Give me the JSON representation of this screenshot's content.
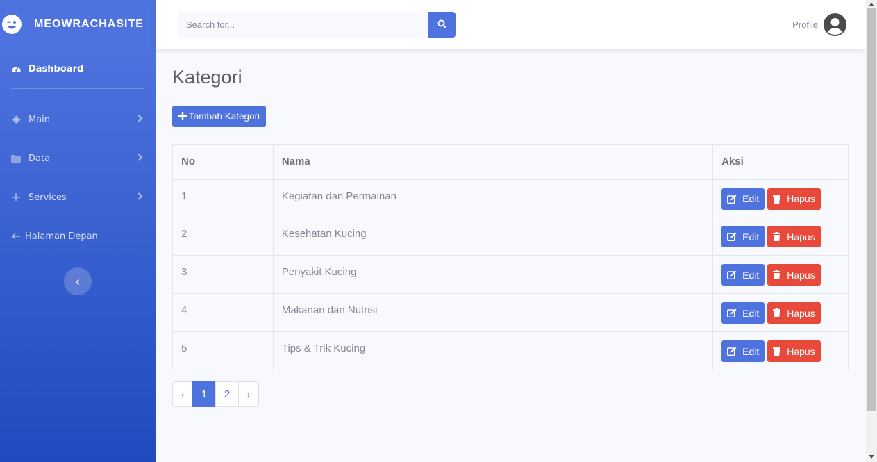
{
  "sidebar": {
    "brand": "MEOWRACHASITE",
    "dashboard": "Dashboard",
    "items": [
      {
        "label": "Main",
        "icon": "gear-icon"
      },
      {
        "label": "Data",
        "icon": "folder-icon"
      },
      {
        "label": "Services",
        "icon": "plus-icon"
      }
    ],
    "back_label": "Halaman Depan"
  },
  "topbar": {
    "search_placeholder": "Search for...",
    "profile_label": "Profile"
  },
  "main": {
    "title": "Kategori",
    "add_button": "Tambah Kategori",
    "table": {
      "headers": {
        "no": "No",
        "nama": "Nama",
        "aksi": "Aksi"
      },
      "rows": [
        {
          "no": "1",
          "nama": "Kegiatan dan Permainan"
        },
        {
          "no": "2",
          "nama": "Kesehatan Kucing"
        },
        {
          "no": "3",
          "nama": "Penyakit Kucing"
        },
        {
          "no": "4",
          "nama": "Makanan dan Nutrisi"
        },
        {
          "no": "5",
          "nama": "Tips & Trik Kucing"
        }
      ],
      "edit_label": "Edit",
      "delete_label": "Hapus"
    },
    "pagination": {
      "prev": "‹",
      "pages": [
        "1",
        "2"
      ],
      "next": "›",
      "active": "1"
    }
  },
  "colors": {
    "primary": "#4e73df",
    "danger": "#e74a3b",
    "sidebar_bottom": "#224abe"
  }
}
